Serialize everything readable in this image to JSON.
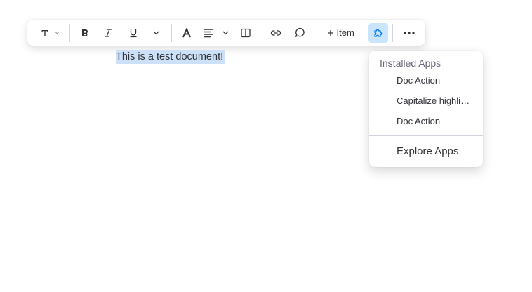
{
  "toolbar": {
    "text_style_icon": "text-T-icon",
    "bold_icon": "bold-icon",
    "italic_icon": "italic-icon",
    "underline_icon": "underline-icon",
    "more_format_icon": "chevron-down-icon",
    "text_color_icon": "text-color-icon",
    "align_icon": "align-left-icon",
    "layout_icon": "columns-icon",
    "link_icon": "link-icon",
    "comment_icon": "comment-icon",
    "item_label": "Item",
    "apps_icon": "puzzle-icon",
    "more_icon": "more-dots-icon",
    "active_color": "#cce5ff"
  },
  "document": {
    "text": "This is a test document!",
    "highlight_color": "#cce1f7"
  },
  "apps_menu": {
    "section_title": "Installed Apps",
    "items": [
      "Doc Action",
      "Capitalize highlig...",
      "Doc Action"
    ],
    "explore_label": "Explore Apps"
  }
}
